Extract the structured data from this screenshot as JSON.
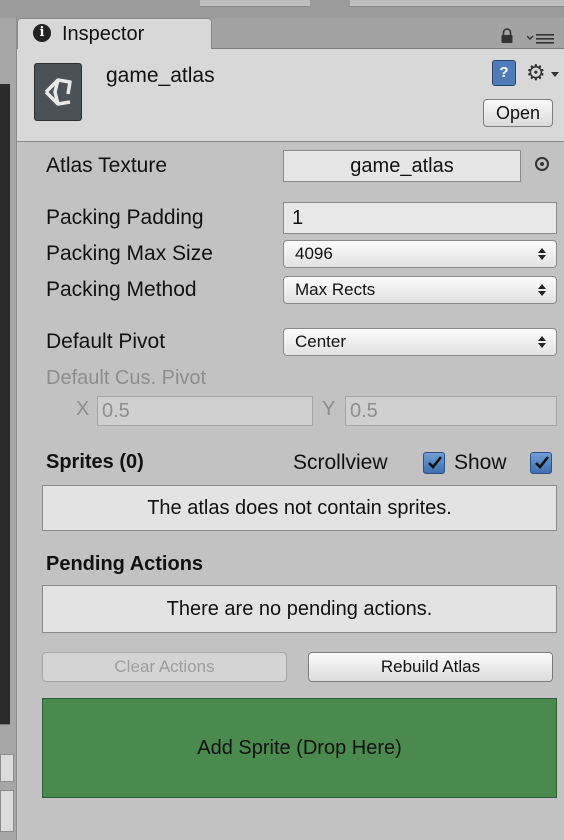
{
  "tab": {
    "icon": "info-icon",
    "label": "Inspector"
  },
  "header": {
    "asset_icon": "unity-logo-icon",
    "asset_name": "game_atlas",
    "help_icon_label": "?",
    "gear_icon": "⚙",
    "open_label": "Open"
  },
  "fields": {
    "atlas_texture_label": "Atlas Texture",
    "atlas_texture_value": "game_atlas",
    "packing_padding_label": "Packing Padding",
    "packing_padding_value": "1",
    "packing_max_size_label": "Packing Max Size",
    "packing_max_size_value": "4096",
    "packing_method_label": "Packing Method",
    "packing_method_value": "Max Rects",
    "default_pivot_label": "Default Pivot",
    "default_pivot_value": "Center",
    "custom_pivot_label": "Default Cus. Pivot",
    "pivot_x_label": "X",
    "pivot_x_value": "0.5",
    "pivot_y_label": "Y",
    "pivot_y_value": "0.5"
  },
  "sprites": {
    "title": "Sprites (0)",
    "scrollview_label": "Scrollview",
    "scrollview_checked": true,
    "show_label": "Show",
    "show_checked": true,
    "empty_message": "The atlas does not contain sprites."
  },
  "pending": {
    "title": "Pending Actions",
    "empty_message": "There are no pending actions.",
    "clear_label": "Clear Actions",
    "rebuild_label": "Rebuild Atlas"
  },
  "dropzone": {
    "label": "Add Sprite (Drop Here)",
    "color": "#4a8a4f"
  }
}
